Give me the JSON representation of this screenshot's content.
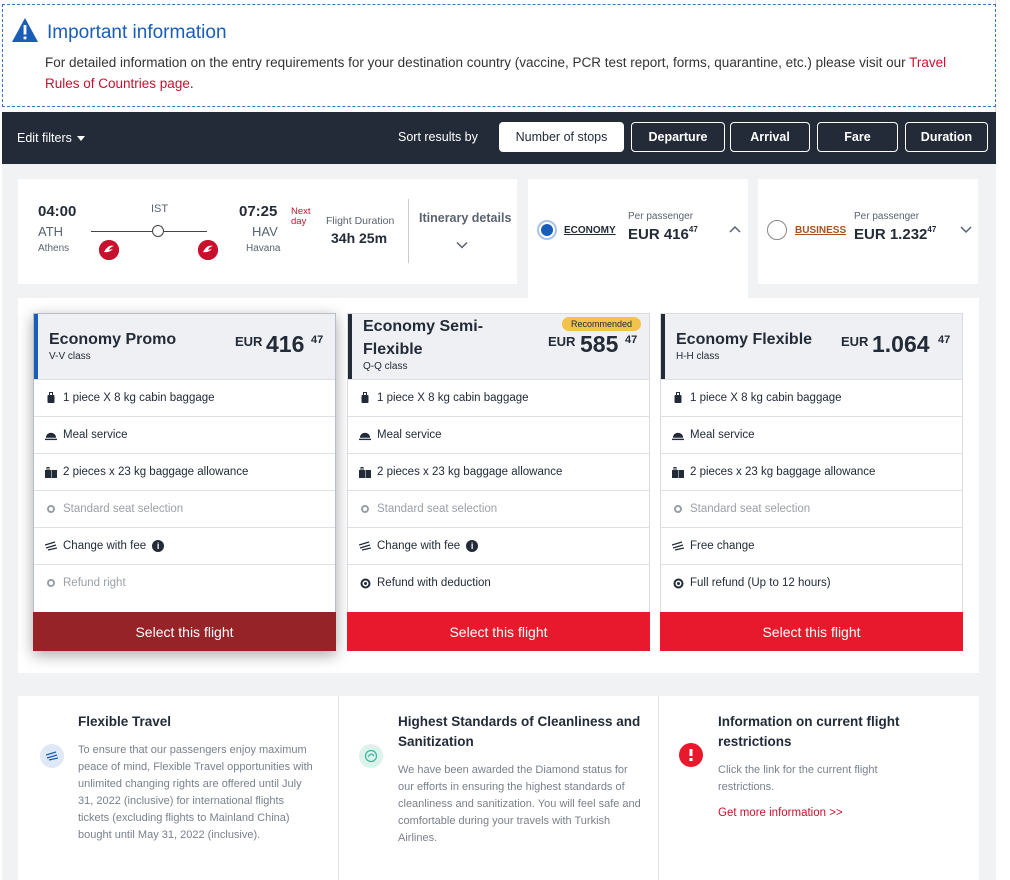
{
  "info": {
    "title": "Important information",
    "text": "For detailed information on the entry requirements for your destination country (vaccine, PCR test report, forms, quarantine, etc.) please visit our ",
    "link": "Travel Rules of Countries page",
    "link_suffix": "."
  },
  "filters": {
    "edit_label": "Edit filters",
    "sort_label": "Sort results by",
    "sort_options": [
      "Number of stops",
      "Departure",
      "Arrival",
      "Fare",
      "Duration"
    ],
    "active_sort": "Number of stops"
  },
  "flight": {
    "dep_time": "04:00",
    "dep_code": "ATH",
    "dep_city": "Athens",
    "stop": "IST",
    "arr_time": "07:25",
    "next_day": "Next day",
    "arr_code": "HAV",
    "arr_city": "Havana",
    "duration_label": "Flight Duration",
    "duration": "34h 25m",
    "itinerary_label": "Itinerary details"
  },
  "classes": [
    {
      "name": "ECONOMY",
      "per_passenger": "Per passenger",
      "currency": "EUR",
      "amount": "416",
      "decimals": "47",
      "selected": true,
      "color": "#1a5db8"
    },
    {
      "name": "BUSINESS",
      "per_passenger": "Per passenger",
      "currency": "EUR",
      "amount": "1.232",
      "decimals": "47",
      "selected": false,
      "color": "#b8731a"
    }
  ],
  "fares": [
    {
      "name": "Economy Promo",
      "class_code": "V-V class",
      "currency": "EUR",
      "amount": "416",
      "decimals": "47",
      "features": [
        {
          "icon": "cabin-baggage-icon",
          "text": "1 piece X 8 kg cabin baggage",
          "muted": false
        },
        {
          "icon": "meal-icon",
          "text": "Meal service",
          "muted": false
        },
        {
          "icon": "baggage-icon",
          "text": "2 pieces x 23 kg baggage allowance",
          "muted": false
        },
        {
          "icon": "seat-icon",
          "text": "Standard seat selection",
          "muted": true
        },
        {
          "icon": "change-icon",
          "text": "Change with fee",
          "muted": false,
          "info": true
        },
        {
          "icon": "refund-icon",
          "text": "Refund right",
          "muted": true
        }
      ],
      "button": "Select this flight"
    },
    {
      "name": "Economy Semi-Flexible",
      "class_code": "Q-Q class",
      "badge": "Recommended",
      "currency": "EUR",
      "amount": "585",
      "decimals": "47",
      "features": [
        {
          "icon": "cabin-baggage-icon",
          "text": "1 piece X 8 kg cabin baggage",
          "muted": false
        },
        {
          "icon": "meal-icon",
          "text": "Meal service",
          "muted": false
        },
        {
          "icon": "baggage-icon",
          "text": "2 pieces x 23 kg baggage allowance",
          "muted": false
        },
        {
          "icon": "seat-icon",
          "text": "Standard seat selection",
          "muted": true
        },
        {
          "icon": "change-icon",
          "text": "Change with fee",
          "muted": false,
          "info": true
        },
        {
          "icon": "refund-icon",
          "text": "Refund with deduction",
          "muted": false
        }
      ],
      "button": "Select this flight"
    },
    {
      "name": "Economy Flexible",
      "class_code": "H-H class",
      "currency": "EUR",
      "amount": "1.064",
      "decimals": "47",
      "features": [
        {
          "icon": "cabin-baggage-icon",
          "text": "1 piece X 8 kg cabin baggage",
          "muted": false
        },
        {
          "icon": "meal-icon",
          "text": "Meal service",
          "muted": false
        },
        {
          "icon": "baggage-icon",
          "text": "2 pieces x 23 kg baggage allowance",
          "muted": false
        },
        {
          "icon": "seat-icon",
          "text": "Standard seat selection",
          "muted": true
        },
        {
          "icon": "change-icon",
          "text": "Free change",
          "muted": false
        },
        {
          "icon": "refund-icon",
          "text": "Full refund (Up to 12 hours)",
          "muted": false
        }
      ],
      "button": "Select this flight"
    }
  ],
  "bottom": [
    {
      "title": "Flexible Travel",
      "text": "To ensure that our passengers enjoy maximum peace of mind, Flexible Travel opportunities with unlimited changing rights are offered until July 31, 2022 (inclusive) for international flights tickets (excluding flights to Mainland China) bought until May 31, 2022 (inclusive).",
      "icon": "flexible-travel-icon"
    },
    {
      "title": "Highest Standards of Cleanliness and Sanitization",
      "text": "We have been awarded the Diamond status for our efforts in ensuring the highest standards of cleanliness and sanitization. You will feel safe and comfortable during your travels with Turkish Airlines.",
      "icon": "sanitization-icon"
    },
    {
      "title": "Information on current flight restrictions",
      "text": "Click the link for the current flight restrictions.",
      "link": "Get more information >>",
      "icon": "alert-icon"
    }
  ]
}
